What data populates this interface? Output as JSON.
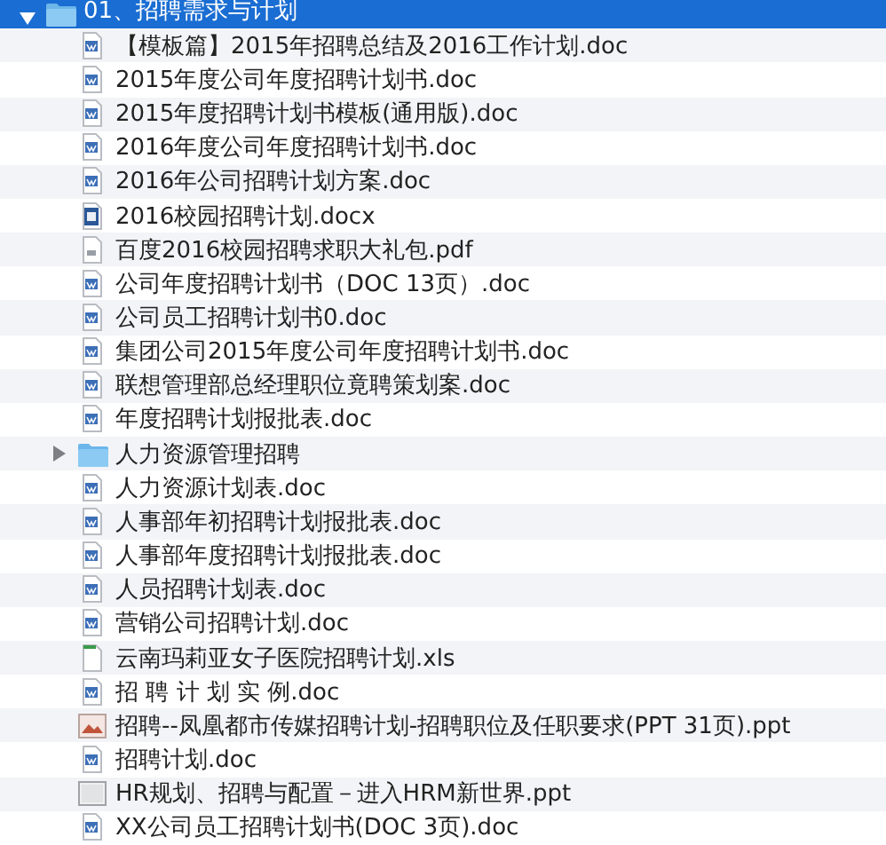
{
  "tree": [
    {
      "name": "01、招聘需求与计划",
      "kind": "folder",
      "expanded": true,
      "selected": true,
      "children": [
        {
          "name": "【模板篇】2015年招聘总结及2016工作计划.doc",
          "kind": "doc",
          "selected": false
        },
        {
          "name": "2015年度公司年度招聘计划书.doc",
          "kind": "doc",
          "selected": false
        },
        {
          "name": "2015年度招聘计划书模板(通用版).doc",
          "kind": "doc",
          "selected": false
        },
        {
          "name": "2016年度公司年度招聘计划书.doc",
          "kind": "doc",
          "selected": false
        },
        {
          "name": "2016年公司招聘计划方案.doc",
          "kind": "doc",
          "selected": false
        },
        {
          "name": "2016校园招聘计划.docx",
          "kind": "docx",
          "selected": false
        },
        {
          "name": "百度2016校园招聘求职大礼包.pdf",
          "kind": "pdf",
          "selected": false
        },
        {
          "name": "公司年度招聘计划书（DOC 13页）.doc",
          "kind": "doc",
          "selected": false
        },
        {
          "name": "公司员工招聘计划书0.doc",
          "kind": "doc",
          "selected": false
        },
        {
          "name": "集团公司2015年度公司年度招聘计划书.doc",
          "kind": "doc",
          "selected": false
        },
        {
          "name": "联想管理部总经理职位竟聘策划案.doc",
          "kind": "doc",
          "selected": false
        },
        {
          "name": "年度招聘计划报批表.doc",
          "kind": "doc",
          "selected": false
        },
        {
          "name": "人力资源管理招聘",
          "kind": "folder",
          "expanded": false,
          "selected": false
        },
        {
          "name": "人力资源计划表.doc",
          "kind": "doc",
          "selected": false
        },
        {
          "name": "人事部年初招聘计划报批表.doc",
          "kind": "doc",
          "selected": false
        },
        {
          "name": "人事部年度招聘计划报批表.doc",
          "kind": "doc",
          "selected": false
        },
        {
          "name": "人员招聘计划表.doc",
          "kind": "doc",
          "selected": false
        },
        {
          "name": "营销公司招聘计划.doc",
          "kind": "doc",
          "selected": false
        },
        {
          "name": "云南玛莉亚女子医院招聘计划.xls",
          "kind": "xls",
          "selected": false
        },
        {
          "name": "招 聘 计 划 实 例.doc",
          "kind": "doc",
          "selected": false
        },
        {
          "name": "招聘--凤凰都市传媒招聘计划-招聘职位及任职要求(PPT 31页).ppt",
          "kind": "ppt-preview",
          "selected": false
        },
        {
          "name": "招聘计划.doc",
          "kind": "doc",
          "selected": false
        },
        {
          "name": "HR规划、招聘与配置－进入HRM新世界.ppt",
          "kind": "ppt",
          "selected": false
        },
        {
          "name": "XX公司员工招聘计划书(DOC 3页).doc",
          "kind": "doc",
          "selected": false
        }
      ]
    }
  ]
}
